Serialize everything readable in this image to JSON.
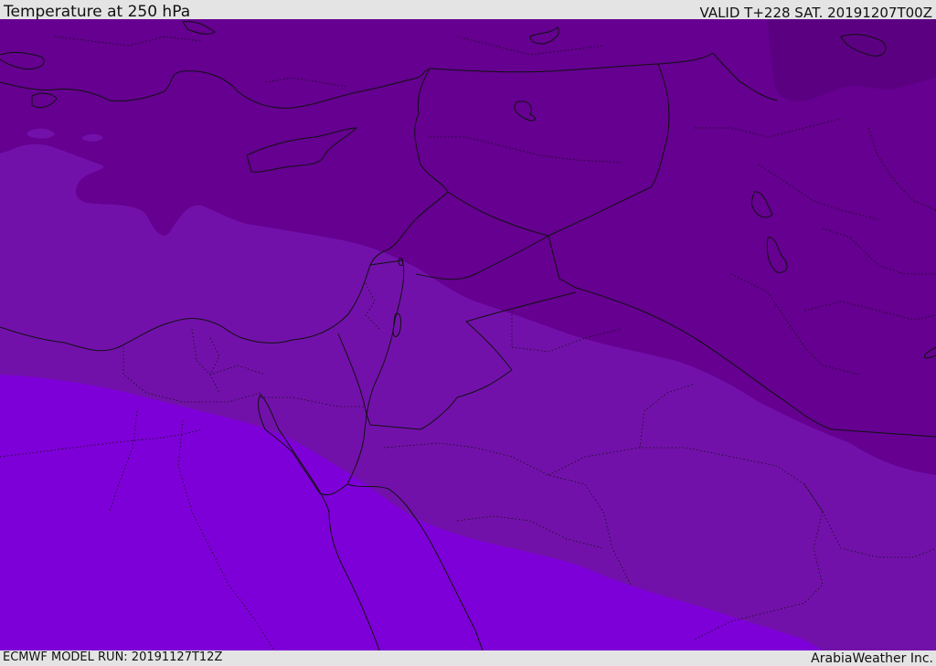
{
  "header": {
    "title": "Temperature at 250 hPa",
    "valid_time": "VALID T+228 SAT. 20191207T00Z"
  },
  "footer": {
    "model_run": "ECMWF MODEL RUN: 20191127T12Z",
    "credit": "ArabiaWeather Inc."
  },
  "map": {
    "bands": [
      {
        "name": "coldest",
        "color": "#5c0082"
      },
      {
        "name": "cold",
        "color": "#650090"
      },
      {
        "name": "mid",
        "color": "#7211aa"
      },
      {
        "name": "warm",
        "color": "#7e00d8"
      }
    ],
    "border_color": "#111111"
  }
}
